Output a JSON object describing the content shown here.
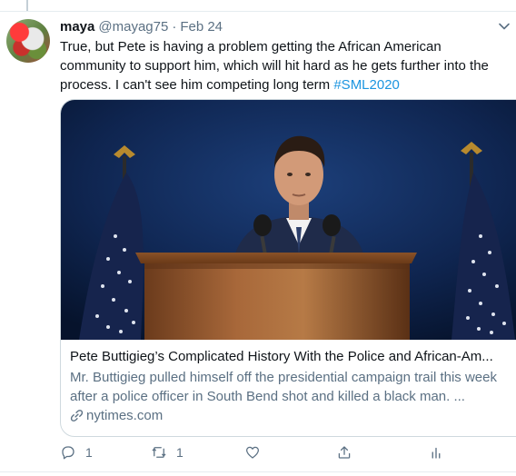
{
  "tweet": {
    "author_name": "maya",
    "author_handle": "@mayag75",
    "separator": "·",
    "date": "Feb 24",
    "text": "True, but Pete is having a problem getting the African American community to support him, which will hit hard as he gets further into the process. I can't see him competing long term ",
    "hashtag": "#SML2020"
  },
  "card": {
    "title": "Pete Buttigieg’s Complicated History With the Police and African-Am...",
    "description": "Mr. Buttigieg pulled himself off the presidential campaign trail this week after a police officer in South Bend shot and killed a black man. ...",
    "domain": "nytimes.com"
  },
  "actions": {
    "reply_count": "1",
    "retweet_count": "1",
    "like_count": "",
    "icons": [
      "reply-icon",
      "retweet-icon",
      "like-icon",
      "share-icon",
      "analytics-icon"
    ]
  },
  "colors": {
    "link": "#1b95e0",
    "secondary_text": "#5b7083",
    "border": "#cfd9de"
  }
}
